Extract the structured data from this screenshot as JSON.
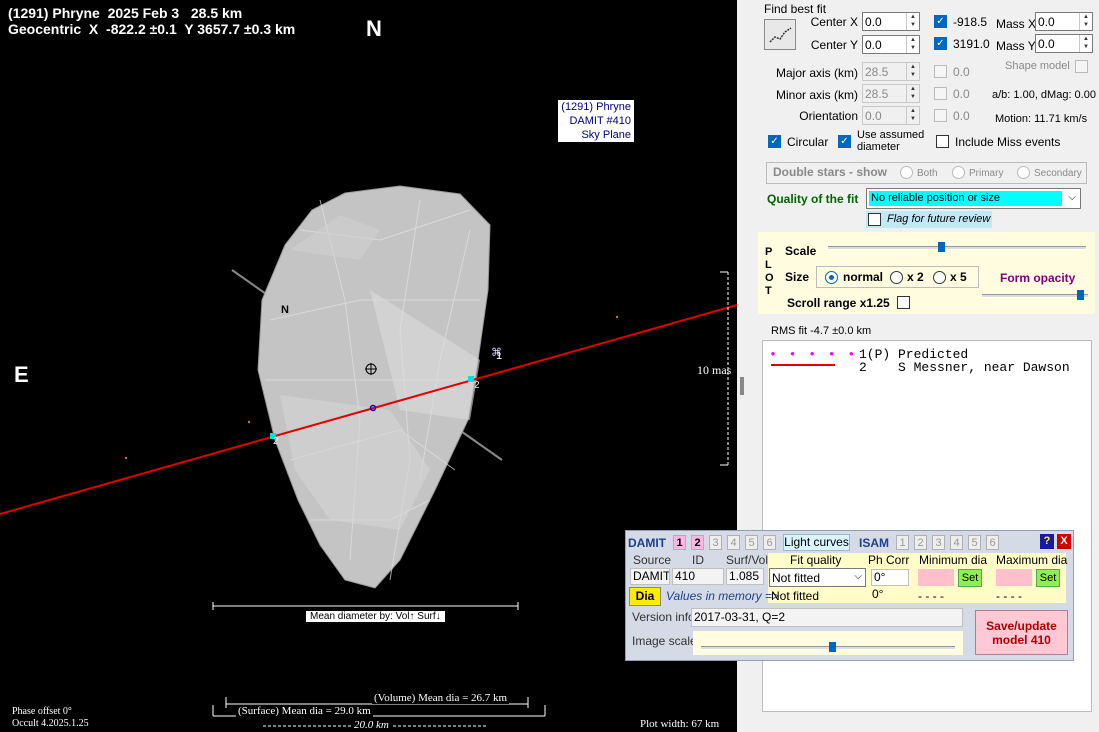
{
  "plot": {
    "title_line1": "(1291) Phryne  2025 Feb 3   28.5 km",
    "title_line2": "Geocentric  X  -822.2 ±0.1  Y 3657.7 ±0.3 km",
    "north": "N",
    "east": "E",
    "sky_info": [
      "(1291) Phryne",
      "DAMIT #410",
      "Sky Plane"
    ],
    "pole_label": "N",
    "chord_labels": [
      "1",
      "2",
      "2"
    ],
    "scale_label": "10 mas",
    "mean_dia_by": "Mean diameter by:  Vol↑  Surf↓",
    "volume_mean": "(Volume) Mean dia = 26.7 km",
    "surface_mean": "(Surface) Mean dia = 29.0 km",
    "scale_bar_20km": "20.0 km",
    "phase_offset": "Phase offset 0°",
    "version": "Occult 4.2025.1.25",
    "plot_width": "Plot width:  67 km"
  },
  "fit": {
    "find_best_fit": "Find best fit",
    "center_x_label": "Center X",
    "center_x": "0.0",
    "center_y_label": "Center Y",
    "center_y": "0.0",
    "x_checked_value": "-918.5",
    "y_checked_value": "3191.0",
    "mass_x_label": "Mass X",
    "mass_x": "0.0",
    "mass_y_label": "Mass Y",
    "mass_y": "0.0",
    "major_label": "Major axis (km)",
    "major": "28.5",
    "major_check_val": "0.0",
    "minor_label": "Minor axis (km)",
    "minor": "28.5",
    "minor_check_val": "0.0",
    "orient_label": "Orientation",
    "orient": "0.0",
    "orient_check_val": "0.0",
    "shape_model": "Shape model",
    "ab_dmag": "a/b: 1.00, dMag: 0.00",
    "motion": "Motion: 11.71 km/s",
    "circular": "Circular",
    "use_assumed": "Use assumed diameter",
    "include_miss": "Include Miss events",
    "double_stars": "Double stars - show",
    "both": "Both",
    "primary": "Primary",
    "secondary": "Secondary",
    "quality_label": "Quality of the fit",
    "quality_value": "No reliable position or size",
    "flag_review": "Flag for future review"
  },
  "plotctl": {
    "plot_letters": [
      "P",
      "L",
      "O",
      "T"
    ],
    "scale": "Scale",
    "size": "Size",
    "normal": "normal",
    "x2": "x 2",
    "x5": "x 5",
    "form_opacity": "Form opacity",
    "scroll_range": "Scroll range x1.25",
    "scale_level": 0.44,
    "opacity_level": 0.96
  },
  "rms": "RMS fit -4.7 ±0.0 km",
  "legend": [
    {
      "marker": "• • • • •",
      "text": "1(P) Predicted"
    },
    {
      "marker": "",
      "text": "2    S Messner, near Dawson"
    }
  ],
  "damit": {
    "damit_label": "DAMIT",
    "damit_nums": [
      "1",
      "2",
      "3",
      "4",
      "5",
      "6"
    ],
    "light_curves": "Light curves",
    "isam_label": "ISAM",
    "isam_nums": [
      "1",
      "2",
      "3",
      "4",
      "5",
      "6"
    ],
    "help": "?",
    "close": "X",
    "source_h": "Source",
    "id_h": "ID",
    "surfvol_h": "Surf/Vol",
    "source": "DAMIT",
    "id": "410",
    "surfvol": "1.085",
    "fit_quality_h": "Fit quality",
    "ph_corr_h": "Ph Corr",
    "min_dia_h": "Minimum dia",
    "max_dia_h": "Maximum dia",
    "fit_quality": "Not fitted",
    "ph_corr": "0°",
    "set": "Set",
    "dia": "Dia",
    "values_mem": "Values in memory =>",
    "mem_fit": "Not fitted",
    "mem_ph": "0°",
    "mem_min": "- - - -",
    "mem_max": "- - - -",
    "version_info_label": "Version info",
    "version_info": "2017-03-31, Q=2",
    "image_scale": "Image scale",
    "image_scale_level": 0.52,
    "save_btn": "Save/update model 410"
  }
}
